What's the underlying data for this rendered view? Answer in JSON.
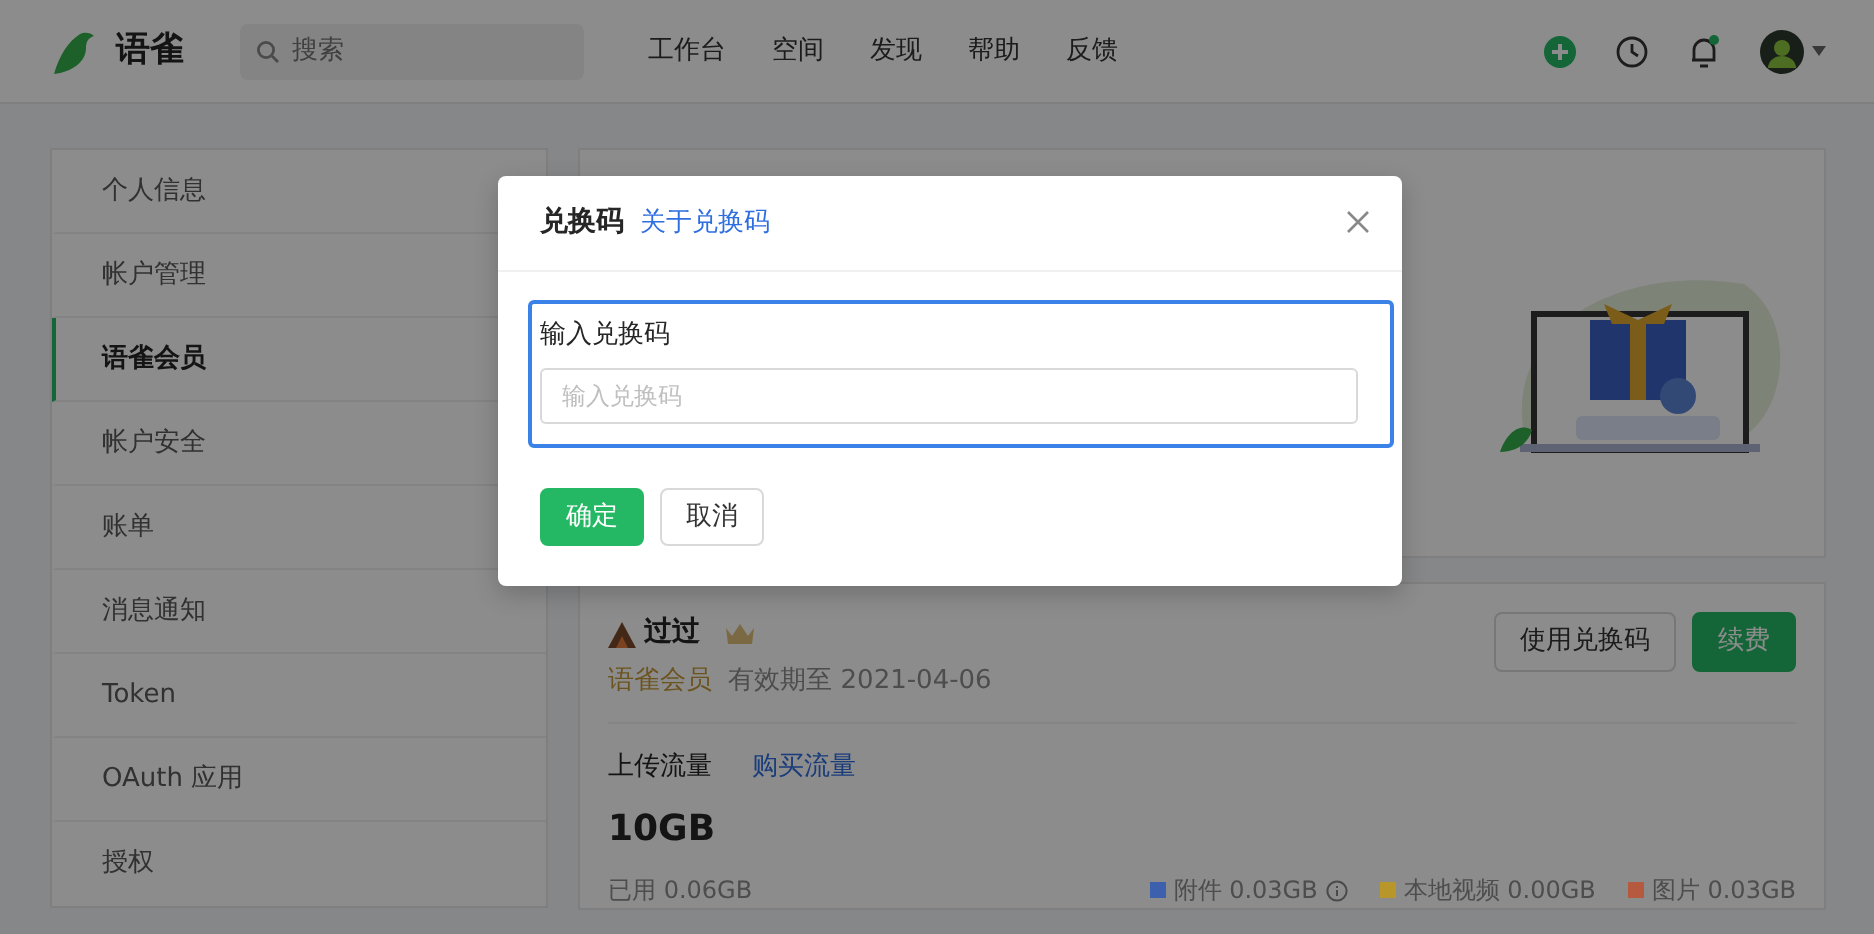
{
  "app": {
    "name": "语雀"
  },
  "search": {
    "placeholder": "搜索"
  },
  "nav": [
    {
      "label": "工作台"
    },
    {
      "label": "空间"
    },
    {
      "label": "发现"
    },
    {
      "label": "帮助"
    },
    {
      "label": "反馈"
    }
  ],
  "sidebar": {
    "items": [
      {
        "label": "个人信息",
        "selected": false
      },
      {
        "label": "帐户管理",
        "selected": false
      },
      {
        "label": "语雀会员",
        "selected": true
      },
      {
        "label": "帐户安全",
        "selected": false
      },
      {
        "label": "账单",
        "selected": false
      },
      {
        "label": "消息通知",
        "selected": false
      },
      {
        "label": "Token",
        "selected": false
      },
      {
        "label": "OAuth 应用",
        "selected": false
      },
      {
        "label": "授权",
        "selected": false
      }
    ]
  },
  "membership": {
    "user_name": "过过",
    "level": "语雀会员",
    "expiry": "有效期至 2021-04-06",
    "buttons": [
      {
        "label": "使用兑换码",
        "kind": "outline"
      },
      {
        "label": "续费",
        "kind": "primary"
      }
    ]
  },
  "upload": {
    "label": "上传流量",
    "link": "购买流量",
    "amount": "10GB",
    "used": "已用 0.06GB",
    "legend": [
      {
        "label": "附件 0.03GB",
        "color": "#3c5fae",
        "info": true
      },
      {
        "label": "本地视频 0.00GB",
        "color": "#b8962a",
        "info": false
      },
      {
        "label": "图片 0.03GB",
        "color": "#b55a3e",
        "info": false
      }
    ]
  },
  "modal": {
    "title": "兑换码",
    "link": "关于兑换码",
    "field_label": "输入兑换码",
    "placeholder": "输入兑换码",
    "buttons": [
      {
        "label": "确定",
        "kind": "primary"
      },
      {
        "label": "取消",
        "kind": "outline"
      }
    ]
  }
}
